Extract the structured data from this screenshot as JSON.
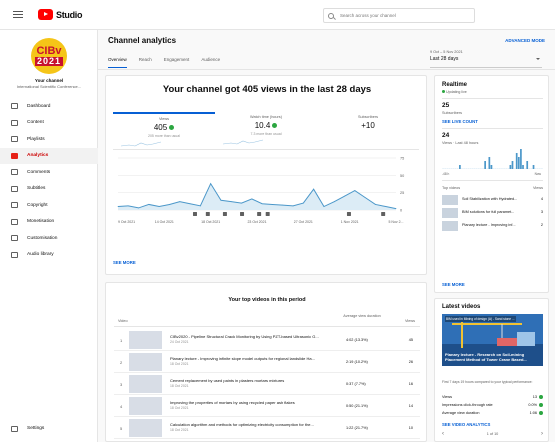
{
  "header": {
    "app_name": "Studio",
    "search_placeholder": "Search across your channel"
  },
  "sidebar": {
    "avatar_line1": "CIBv",
    "avatar_line2": "2021",
    "channel_label": "Your channel",
    "channel_name": "International Scientific Conference...",
    "items": [
      {
        "label": "Dashboard",
        "icon": "dashboard-icon"
      },
      {
        "label": "Content",
        "icon": "content-icon"
      },
      {
        "label": "Playlists",
        "icon": "playlists-icon"
      },
      {
        "label": "Analytics",
        "icon": "analytics-icon",
        "active": true
      },
      {
        "label": "Comments",
        "icon": "comments-icon"
      },
      {
        "label": "Subtitles",
        "icon": "subtitles-icon"
      },
      {
        "label": "Copyright",
        "icon": "copyright-icon"
      },
      {
        "label": "Monetisation",
        "icon": "monetisation-icon"
      },
      {
        "label": "Customisation",
        "icon": "customisation-icon"
      },
      {
        "label": "Audio library",
        "icon": "audio-library-icon"
      }
    ],
    "bottom_items": [
      {
        "label": "Settings",
        "icon": "settings-icon"
      }
    ]
  },
  "main": {
    "title": "Channel analytics",
    "advanced_mode": "ADVANCED MODE",
    "tabs": [
      "Overview",
      "Reach",
      "Engagement",
      "Audience"
    ],
    "date_range_sub": "9 Oct – 5 Nov 2021",
    "date_range": "Last 28 days",
    "headline": "Your channel got 405 views in the last 28 days",
    "stats": [
      {
        "label": "Views",
        "value": "405",
        "note": "205 more than usual"
      },
      {
        "label": "Watch time (hours)",
        "value": "10.4",
        "note": "7.3 more than usual"
      },
      {
        "label": "Subscribers",
        "value": "+10",
        "note": ""
      }
    ],
    "see_more": "SEE MORE"
  },
  "chart_data": {
    "type": "line",
    "x": [
      "9 Oct 2021",
      "14 Oct 2021",
      "18 Oct 2021",
      "23 Oct 2021",
      "27 Oct 2021",
      "1 Nov 2021",
      "5 Nov 2..."
    ],
    "series": [
      {
        "values": [
          5,
          6,
          3,
          8,
          5,
          8,
          12,
          9,
          6,
          38,
          14,
          12,
          10,
          16,
          9,
          8,
          7,
          6,
          10,
          30,
          5,
          12,
          20,
          28,
          18,
          8,
          5,
          2
        ]
      }
    ],
    "ylim": [
      0,
      75
    ],
    "yticks": [
      0,
      25,
      50,
      75
    ],
    "grid": true
  },
  "top_videos": {
    "title": "Your top videos in this period",
    "col_video": "Video",
    "col_avd": "Average view duration",
    "col_views": "Views",
    "rows": [
      {
        "n": "1",
        "title": "CIBv2020 - Pipeline Structural Crack Monitoring by Using PZT-based Ultrasonic G...",
        "date": "24 Oct 2021",
        "avd": "4:02  (13.3%)",
        "views": "45"
      },
      {
        "n": "2",
        "title": "Planary lecture - Improving infinite slope model outputs for regional landslide Ha...",
        "date": "18 Oct 2021",
        "avd": "2:19  (10.2%)",
        "views": "26"
      },
      {
        "n": "3",
        "title": "Cement replacement by used paints in plasters mortars mixtures",
        "date": "18 Oct 2021",
        "avd": "0:37  (7.7%)",
        "views": "16"
      },
      {
        "n": "4",
        "title": "Improving the properties of mortars by using recycled paper ash flakes",
        "date": "18 Oct 2021",
        "avd": "0:50  (21.1%)",
        "views": "14"
      },
      {
        "n": "5",
        "title": "Calculation algorithm and methods for optimizing electricity consumption for the...",
        "date": "18 Oct 2021",
        "avd": "1:22  (21.7%)",
        "views": "10"
      }
    ]
  },
  "realtime": {
    "title": "Realtime",
    "updating": "Updating live",
    "subscribers_value": "25",
    "subscribers_label": "Subscribers",
    "see_live_count": "SEE LIVE COUNT",
    "views_value": "24",
    "views_label": "Views · Last 48 hours",
    "bars": [
      0,
      0,
      0,
      0,
      0,
      0,
      0,
      0,
      1,
      0,
      0,
      0,
      0,
      0,
      0,
      0,
      0,
      0,
      0,
      0,
      2,
      0,
      3,
      1,
      0,
      0,
      0,
      0,
      0,
      0,
      0,
      0,
      1,
      2,
      0,
      4,
      3,
      5,
      1,
      0,
      2,
      0,
      0,
      1,
      0,
      0,
      0,
      0
    ],
    "axis_left": "-48 h",
    "axis_right": "Now",
    "top_videos_label": "Top videos",
    "top_videos_col": "Views",
    "videos": [
      {
        "title": "Soil Stabilization with Hydrated...",
        "views": "4"
      },
      {
        "title": "BIM solutions for full paramet...",
        "views": "3"
      },
      {
        "title": "Planary lecture - Improving inf...",
        "views": "2"
      }
    ],
    "see_more": "SEE MORE"
  },
  "latest": {
    "title": "Latest videos",
    "thumb_top": "BIM used in Mining of design (A) - Sand stone ... ",
    "thumb_title": "Planary lecture - Research on Soil-mining Placement Method of Tower Crane Based...",
    "note": "First 7 days 19 hours compared to your typical performance:",
    "rows": [
      {
        "label": "Views",
        "value": "13"
      },
      {
        "label": "Impressions click-through rate",
        "value": "0.0%"
      },
      {
        "label": "Average view duration",
        "value": "1:06"
      }
    ],
    "see_analytics": "SEE VIDEO ANALYTICS",
    "pager": "1 of 10"
  }
}
